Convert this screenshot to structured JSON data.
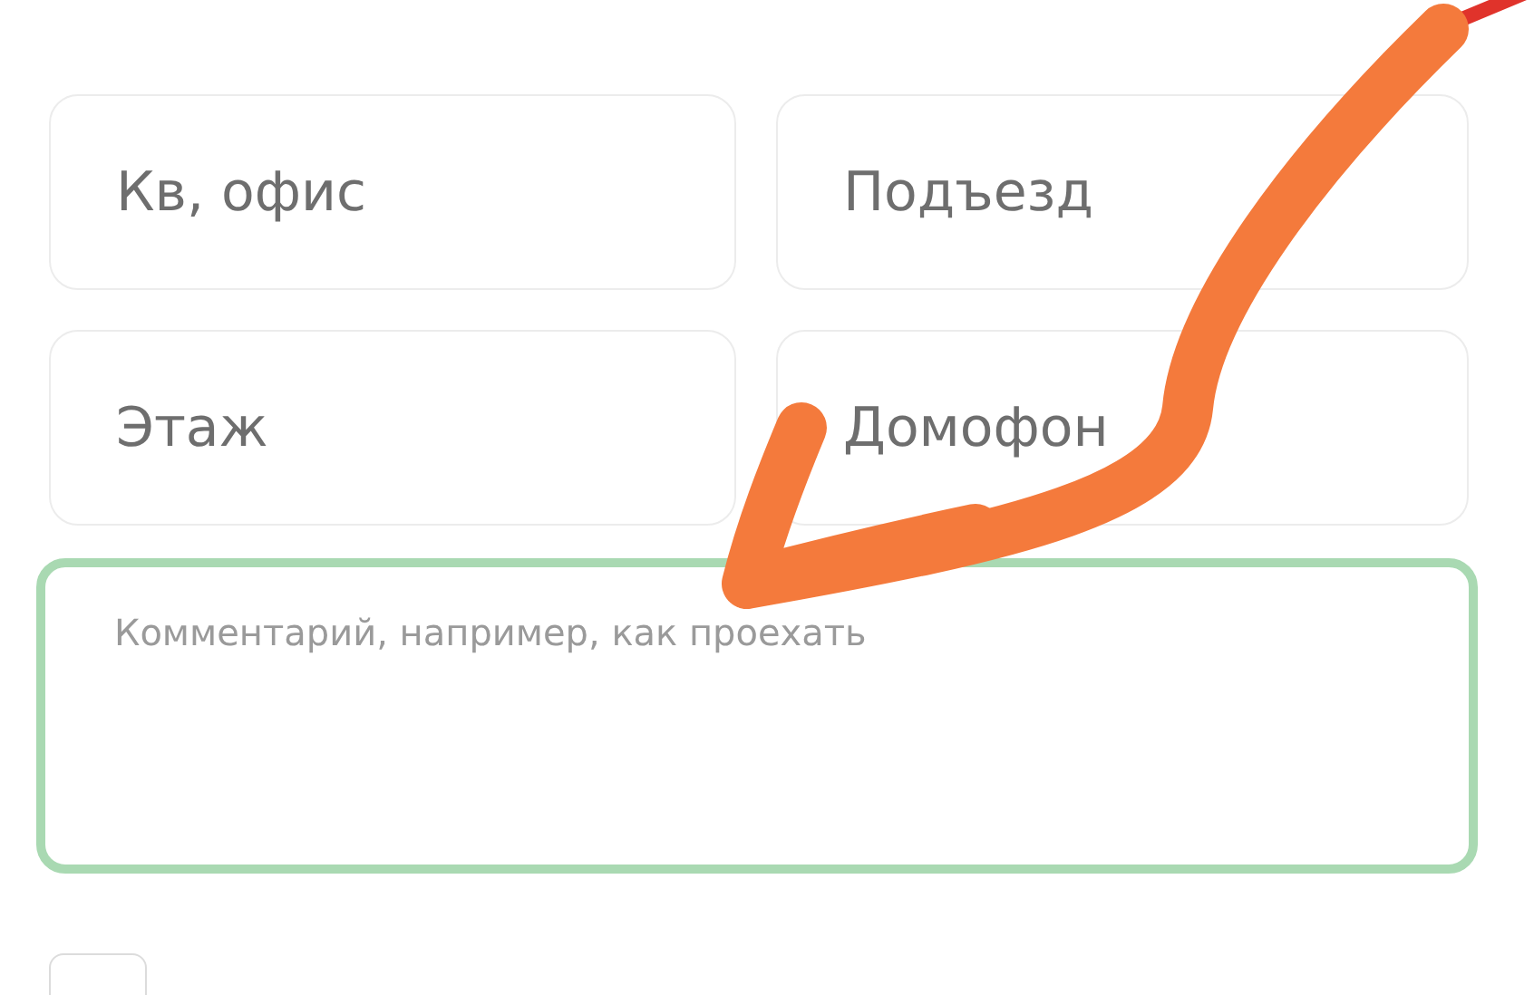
{
  "fields": [
    {
      "placeholder": "Кв, офис"
    },
    {
      "placeholder": "Подъезд"
    },
    {
      "placeholder": "Этаж"
    },
    {
      "placeholder": "Домофон"
    }
  ],
  "comment": {
    "placeholder": "Комментарий, например, как проехать",
    "focused": true
  },
  "agree_checkbox": {
    "checked": false
  }
}
